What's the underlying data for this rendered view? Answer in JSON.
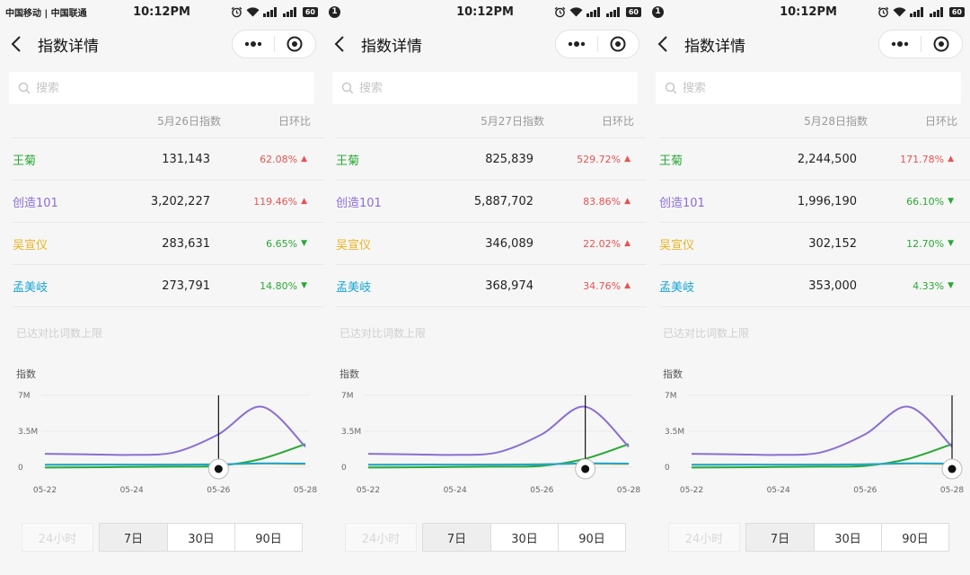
{
  "status_bar": {
    "carrier": "中国移动 | 中国联通",
    "notification_count": "1",
    "time": "10:12PM",
    "battery": "60"
  },
  "nav": {
    "title": "指数详情"
  },
  "search": {
    "placeholder": "搜索"
  },
  "table_header": {
    "change": "日环比"
  },
  "limit_note": "已达对比词数上限",
  "chart_ylabel": "指数",
  "tabs": {
    "h24": "24小时",
    "d7": "7日",
    "d30": "30日",
    "d90": "90日",
    "active": "7日"
  },
  "colors": {
    "王菊": "#2aa836",
    "创造101": "#8a6fd4",
    "吴宣仪": "#e9b321",
    "孟美岐": "#1aa6d6",
    "up": "#e95252",
    "down": "#2aa836"
  },
  "panels": [
    {
      "header_index": "5月26日指数",
      "rows": [
        {
          "name": "王菊",
          "value": "131,143",
          "change": "62.08%",
          "dir": "up"
        },
        {
          "name": "创造101",
          "value": "3,202,227",
          "change": "119.46%",
          "dir": "up"
        },
        {
          "name": "吴宣仪",
          "value": "283,631",
          "change": "6.65%",
          "dir": "down"
        },
        {
          "name": "孟美岐",
          "value": "273,791",
          "change": "14.80%",
          "dir": "down"
        }
      ],
      "selected_date": "05-26"
    },
    {
      "header_index": "5月27日指数",
      "rows": [
        {
          "name": "王菊",
          "value": "825,839",
          "change": "529.72%",
          "dir": "up"
        },
        {
          "name": "创造101",
          "value": "5,887,702",
          "change": "83.86%",
          "dir": "up"
        },
        {
          "name": "吴宣仪",
          "value": "346,089",
          "change": "22.02%",
          "dir": "up"
        },
        {
          "name": "孟美岐",
          "value": "368,974",
          "change": "34.76%",
          "dir": "up"
        }
      ],
      "selected_date": "05-27"
    },
    {
      "header_index": "5月28日指数",
      "rows": [
        {
          "name": "王菊",
          "value": "2,244,500",
          "change": "171.78%",
          "dir": "up"
        },
        {
          "name": "创造101",
          "value": "1,996,190",
          "change": "66.10%",
          "dir": "down"
        },
        {
          "name": "吴宣仪",
          "value": "302,152",
          "change": "12.70%",
          "dir": "down"
        },
        {
          "name": "孟美岐",
          "value": "353,000",
          "change": "4.33%",
          "dir": "down"
        }
      ],
      "selected_date": "05-28"
    }
  ],
  "chart_data": {
    "type": "line",
    "x": [
      "05-22",
      "05-23",
      "05-24",
      "05-25",
      "05-26",
      "05-27",
      "05-28"
    ],
    "xticks": [
      "05-22",
      "05-24",
      "05-26",
      "05-28"
    ],
    "yticks": [
      "0",
      "3.5M",
      "7M"
    ],
    "ylim": [
      0,
      7000000
    ],
    "series": [
      {
        "name": "王菊",
        "values": [
          -30000,
          -10000,
          20000,
          50000,
          131143,
          825839,
          2244500
        ]
      },
      {
        "name": "创造101",
        "values": [
          1300000,
          1250000,
          1200000,
          1459000,
          3202227,
          5887702,
          1996190
        ]
      },
      {
        "name": "吴宣仪",
        "values": [
          250000,
          260000,
          255000,
          266000,
          283631,
          346089,
          302152
        ]
      },
      {
        "name": "孟美岐",
        "values": [
          230000,
          235000,
          240000,
          238000,
          273791,
          368974,
          353000
        ]
      }
    ]
  }
}
